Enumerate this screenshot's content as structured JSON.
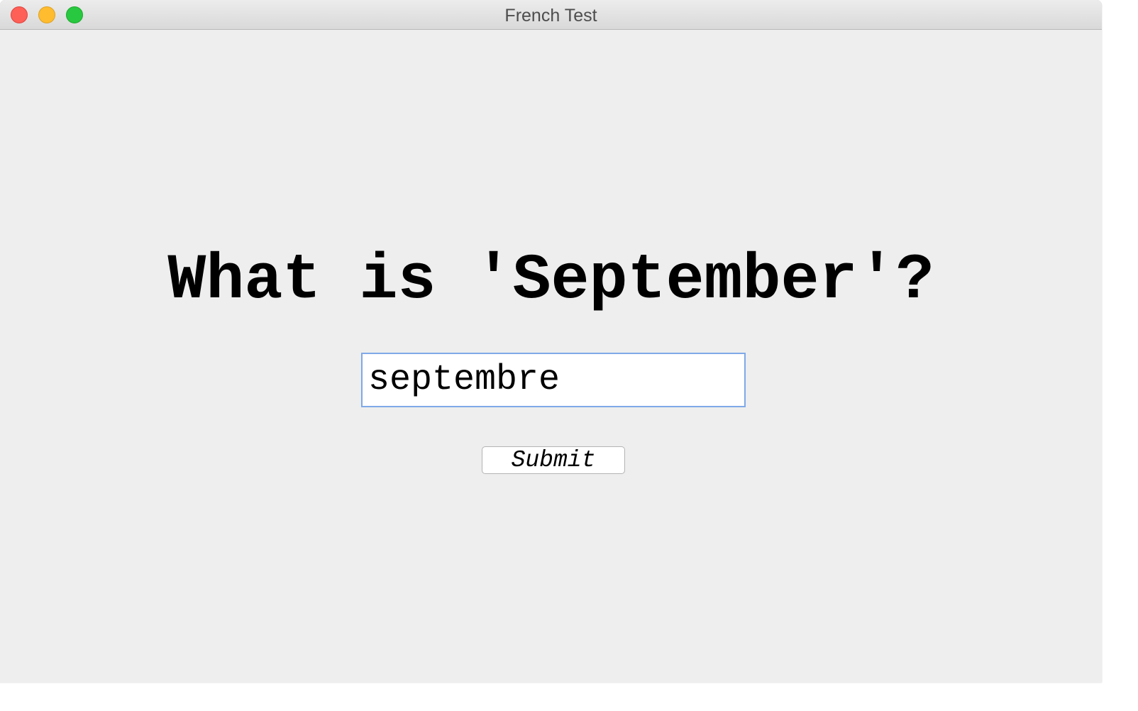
{
  "window": {
    "title": "French Test"
  },
  "quiz": {
    "question": "What is 'September'?",
    "answer_value": "septembre",
    "submit_label": "Submit"
  },
  "colors": {
    "window_background": "#eeeeee",
    "input_focus_border": "#7fa9e8",
    "close": "#fe5f57",
    "minimize": "#febc2e",
    "zoom": "#28c840"
  }
}
